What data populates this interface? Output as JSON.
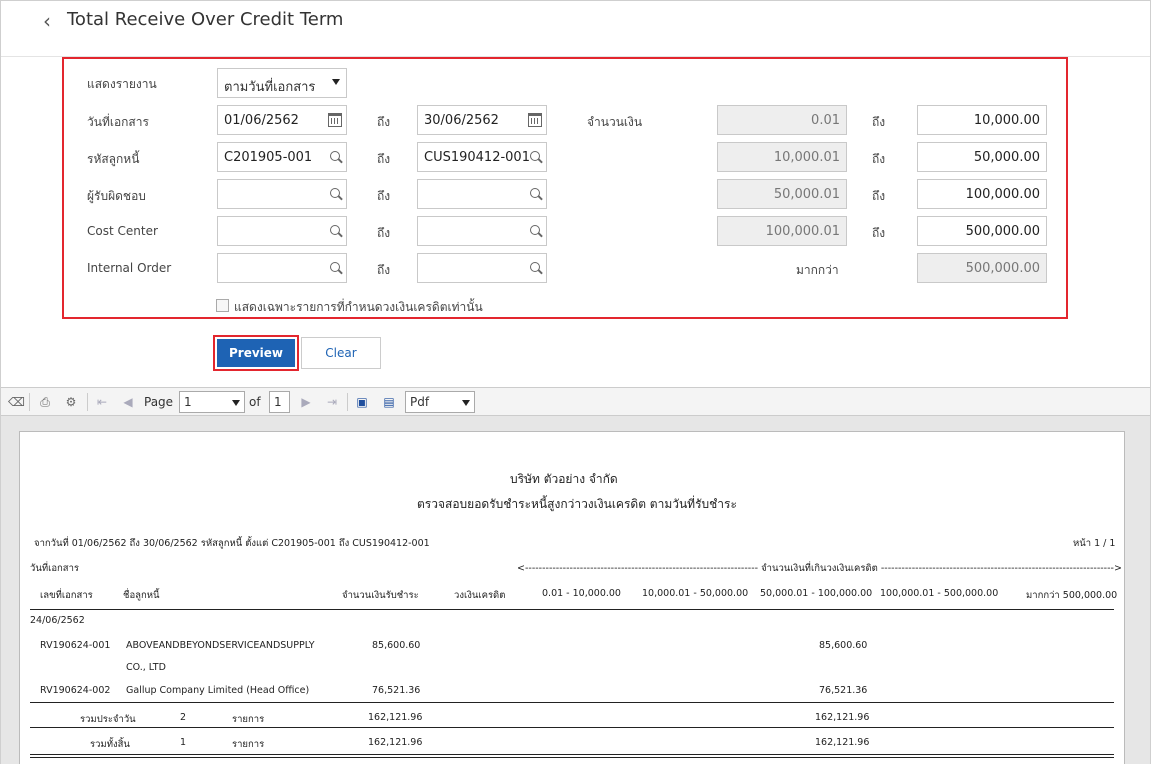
{
  "header": {
    "title": "Total Receive Over Credit Term"
  },
  "form": {
    "report_label": "แสดงรายงาน",
    "report_value": "ตามวันที่เอกสาร",
    "doc_date_label": "วันที่เอกสาร",
    "doc_date_from": "01/06/2562",
    "doc_date_to": "30/06/2562",
    "customer_label": "รหัสลูกหนี้",
    "customer_from": "C201905-001",
    "customer_to": "CUS190412-001",
    "responsible_label": "ผู้รับผิดชอบ",
    "cost_center_label": "Cost Center",
    "internal_order_label": "Internal Order",
    "to_label": "ถึง",
    "amount_label": "จำนวนเงิน",
    "more_than_label": "มากกว่า",
    "ranges": [
      {
        "from": "0.01",
        "to": "10,000.00"
      },
      {
        "from": "10,000.01",
        "to": "50,000.00"
      },
      {
        "from": "50,000.01",
        "to": "100,000.00"
      },
      {
        "from": "100,000.01",
        "to": "500,000.00"
      }
    ],
    "more_than_value": "500,000.00",
    "checkbox_label": "แสดงเฉพาะรายการที่กำหนดวงเงินเครดิตเท่านั้น"
  },
  "buttons": {
    "preview": "Preview",
    "clear": "Clear"
  },
  "toolbar": {
    "page_label": "Page",
    "page_value": "1",
    "of_label": "of",
    "total_pages": "1",
    "format": "Pdf"
  },
  "report": {
    "company": "บริษัท ตัวอย่าง จำกัด",
    "subtitle": "ตรวจสอบยอดรับชำระหนี้สูงกว่าวงเงินเครดิต ตามวันที่รับชำระ",
    "criteria": "จากวันที่ 01/06/2562 ถึง 30/06/2562 รหัสลูกหนี้ ตั้งแต่ C201905-001 ถึง CUS190412-001",
    "page_info": "หน้า 1 / 1",
    "col_doc_date": "วันที่เอกสาร",
    "range_header": "<-------------------------------------------------------------------- จำนวนเงินที่เกินวงเงินเครดิต -------------------------------------------------------------------->",
    "columns": [
      "เลขที่เอกสาร",
      "ชื่อลูกหนี้",
      "จำนวนเงินรับชำระ",
      "วงเงินเครดิต",
      "0.01 - 10,000.00",
      "10,000.01 - 50,000.00",
      "50,000.01 - 100,000.00",
      "100,000.01 - 500,000.00",
      "มากกว่า 500,000.00"
    ],
    "group_date": "24/06/2562",
    "rows": [
      {
        "doc": "RV190624-001",
        "name1": "ABOVEANDBEYONDSERVICEANDSUPPLY",
        "name2": "CO., LTD",
        "amount": "85,600.60",
        "range3": "85,600.60"
      },
      {
        "doc": "RV190624-002",
        "name1": "Gallup Company Limited (Head Office)",
        "amount": "76,521.36",
        "range3": "76,521.36"
      }
    ],
    "daily_total": {
      "label": "รวมประจำวัน",
      "count": "2",
      "unit": "รายการ",
      "amount": "162,121.96",
      "range3": "162,121.96"
    },
    "grand_total": {
      "label": "รวมทั้งสิ้น",
      "count": "1",
      "unit": "รายการ",
      "amount": "162,121.96",
      "range3": "162,121.96"
    }
  }
}
